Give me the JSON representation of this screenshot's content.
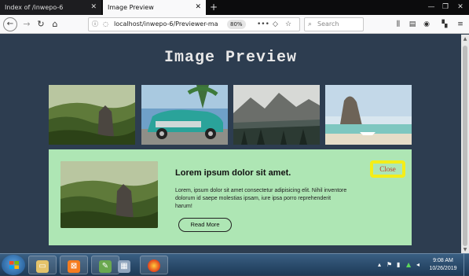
{
  "browser": {
    "tabs": [
      {
        "label": "Index of /inwepo-6",
        "active": false
      },
      {
        "label": "Image Preview",
        "active": true
      }
    ],
    "new_tab_symbol": "+",
    "url": "localhost/inwepo-6/Previewer-ma",
    "zoom": "80%",
    "search_placeholder": "Search",
    "page_actions_symbol": "•••"
  },
  "page": {
    "title": "Image Preview",
    "thumbnails": [
      {
        "name": "rock-forest",
        "icon": "landscape-rock-forest"
      },
      {
        "name": "classic-car",
        "icon": "teal-classic-car"
      },
      {
        "name": "mountain-lake",
        "icon": "mountain-lake"
      },
      {
        "name": "beach-rock",
        "icon": "beach-rock"
      }
    ],
    "preview": {
      "heading": "Lorem ipsum dolor sit amet.",
      "body": "Lorem, ipsum dolor sit amet consectetur adipisicing elit. Nihil inventore dolorum id saepe molestias ipsam, iure ipsa porro reprehenderit harum!",
      "read_more_label": "Read More",
      "close_label": "Close",
      "background_color": "#aee6b4",
      "close_border_color": "#f4ee18"
    }
  },
  "taskbar": {
    "time": "9:08 AM",
    "date": "10/26/2019"
  }
}
